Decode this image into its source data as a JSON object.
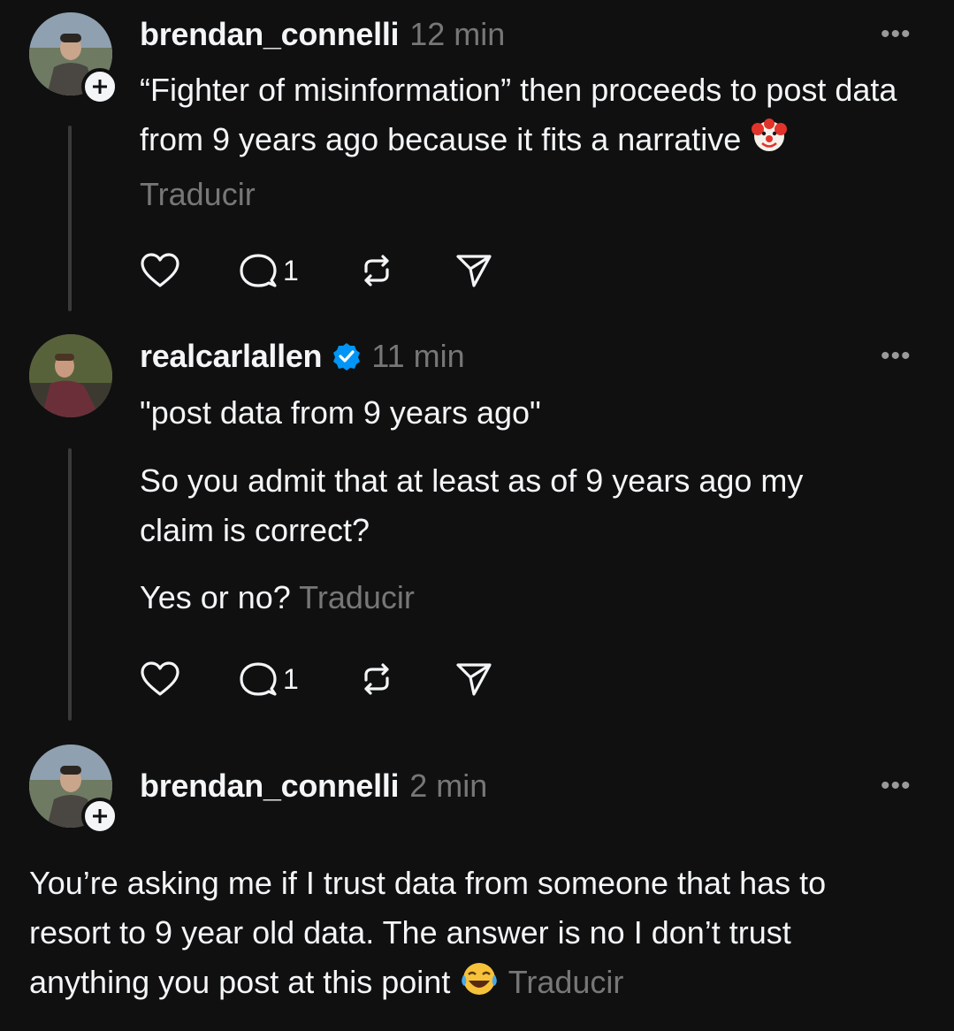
{
  "posts": [
    {
      "username": "brendan_connelli",
      "time": "12 min",
      "text": "“Fighter of misinformation” then proceeds to post data from 9 years ago because it fits a narrative",
      "emoji": "clown-face",
      "translate": "Traducir",
      "reply_count": "1",
      "more": "•••"
    },
    {
      "username": "realcarlallen",
      "verified": true,
      "time": "11 min",
      "p1": "\"post data from 9 years ago\"",
      "p2": "So you admit that at least as of 9 years ago my claim is correct?",
      "p3": "Yes or no?",
      "translate": "Traducir",
      "reply_count": "1",
      "more": "•••"
    },
    {
      "username": "brendan_connelli",
      "time": "2 min",
      "text": "You’re asking me if I trust data from someone that has to resort to 9 year old data. The answer is no I don’t trust anything you post at this point",
      "emoji": "tears-of-joy",
      "translate": "Traducir",
      "more": "•••"
    }
  ],
  "icons": [
    "heart-icon",
    "comment-icon",
    "repost-icon",
    "share-icon",
    "verified-badge-icon",
    "plus-icon"
  ],
  "colors": {
    "background": "#101010",
    "text": "#f3f5f7",
    "muted": "#777777",
    "verified": "#0095f6"
  }
}
